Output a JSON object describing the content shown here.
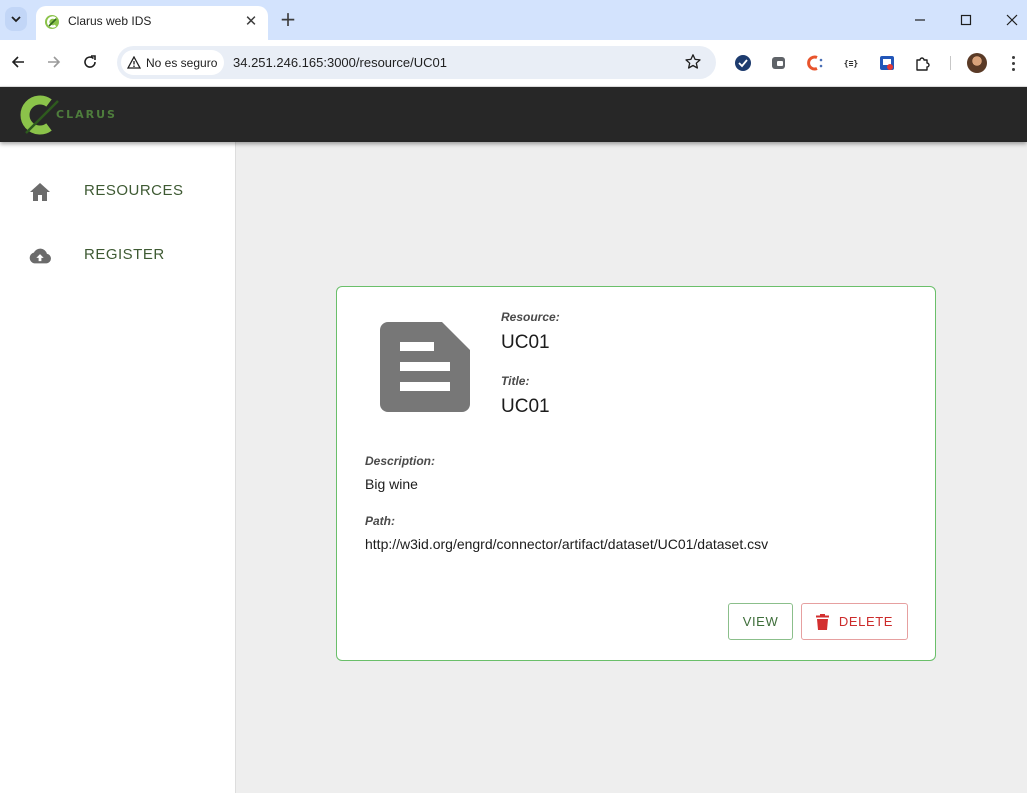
{
  "browser": {
    "tab_title": "Clarus web IDS",
    "security_label": "No es seguro",
    "url": "34.251.246.165:3000/resource/UC01"
  },
  "app": {
    "logo_text": "CLARUS",
    "brand_color": "#7cb342"
  },
  "sidebar": {
    "items": [
      {
        "label": "RESOURCES",
        "icon": "home-icon"
      },
      {
        "label": "REGISTER",
        "icon": "cloud-upload-icon"
      }
    ]
  },
  "resource": {
    "resource_label": "Resource:",
    "resource_value": "UC01",
    "title_label": "Title:",
    "title_value": "UC01",
    "description_label": "Description:",
    "description_value": "Big wine",
    "path_label": "Path:",
    "path_value": "http://w3id.org/engrd/connector/artifact/dataset/UC01/dataset.csv"
  },
  "actions": {
    "view_label": "VIEW",
    "delete_label": "DELETE"
  }
}
